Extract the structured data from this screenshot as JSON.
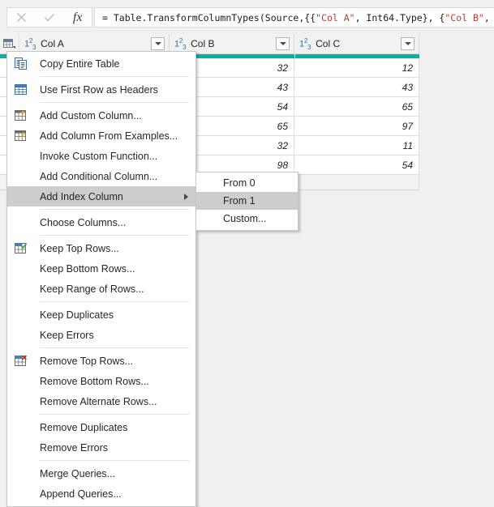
{
  "formula_bar": {
    "cancel_icon": "close-icon",
    "accept_icon": "check-icon",
    "fx_label": "fx",
    "formula_prefix": "= Table.TransformColumnTypes(Source,{{",
    "formula_str1": "\"Col A\"",
    "formula_mid1": ", Int64.Type}, {",
    "formula_str2": "\"Col B\"",
    "formula_suffix": ", Int"
  },
  "grid": {
    "corner_icon": "select-all-table-icon",
    "type_icon_label": "123",
    "columns": [
      {
        "name": "Col A",
        "type": "whole-number",
        "filter_icon": "chevron-down-icon"
      },
      {
        "name": "Col B",
        "type": "whole-number",
        "filter_icon": "chevron-down-icon"
      },
      {
        "name": "Col C",
        "type": "whole-number",
        "filter_icon": "chevron-down-icon"
      }
    ],
    "rows": [
      {
        "a": "",
        "b": "32",
        "c": "12"
      },
      {
        "a": "",
        "b": "43",
        "c": "43"
      },
      {
        "a": "",
        "b": "54",
        "c": "65"
      },
      {
        "a": "",
        "b": "65",
        "c": "97"
      },
      {
        "a": "",
        "b": "32",
        "c": "11"
      },
      {
        "a": "",
        "b": "98",
        "c": "54"
      }
    ],
    "selection_color": "#00b3a4"
  },
  "context_menu": {
    "items": [
      {
        "label": "Copy Entire Table",
        "icon": "copy-icon",
        "sep_after": true,
        "highlight": false,
        "submenu": false
      },
      {
        "label": "Use First Row as Headers",
        "icon": "table-headers-icon",
        "sep_after": true,
        "highlight": false,
        "submenu": false
      },
      {
        "label": "Add Custom Column...",
        "icon": "add-custom-column-icon",
        "sep_after": false,
        "highlight": false,
        "submenu": false
      },
      {
        "label": "Add Column From Examples...",
        "icon": "add-column-examples-icon",
        "sep_after": false,
        "highlight": false,
        "submenu": false
      },
      {
        "label": "Invoke Custom Function...",
        "icon": "none",
        "sep_after": false,
        "highlight": false,
        "submenu": false
      },
      {
        "label": "Add Conditional Column...",
        "icon": "none",
        "sep_after": false,
        "highlight": false,
        "submenu": false
      },
      {
        "label": "Add Index Column",
        "icon": "none",
        "sep_after": true,
        "highlight": true,
        "submenu": true
      },
      {
        "label": "Choose Columns...",
        "icon": "none",
        "sep_after": true,
        "highlight": false,
        "submenu": false
      },
      {
        "label": "Keep Top Rows...",
        "icon": "keep-rows-icon",
        "sep_after": false,
        "highlight": false,
        "submenu": false
      },
      {
        "label": "Keep Bottom Rows...",
        "icon": "none",
        "sep_after": false,
        "highlight": false,
        "submenu": false
      },
      {
        "label": "Keep Range of Rows...",
        "icon": "none",
        "sep_after": true,
        "highlight": false,
        "submenu": false
      },
      {
        "label": "Keep Duplicates",
        "icon": "none",
        "sep_after": false,
        "highlight": false,
        "submenu": false
      },
      {
        "label": "Keep Errors",
        "icon": "none",
        "sep_after": true,
        "highlight": false,
        "submenu": false
      },
      {
        "label": "Remove Top Rows...",
        "icon": "remove-rows-icon",
        "sep_after": false,
        "highlight": false,
        "submenu": false
      },
      {
        "label": "Remove Bottom Rows...",
        "icon": "none",
        "sep_after": false,
        "highlight": false,
        "submenu": false
      },
      {
        "label": "Remove Alternate Rows...",
        "icon": "none",
        "sep_after": true,
        "highlight": false,
        "submenu": false
      },
      {
        "label": "Remove Duplicates",
        "icon": "none",
        "sep_after": false,
        "highlight": false,
        "submenu": false
      },
      {
        "label": "Remove Errors",
        "icon": "none",
        "sep_after": true,
        "highlight": false,
        "submenu": false
      },
      {
        "label": "Merge Queries...",
        "icon": "none",
        "sep_after": false,
        "highlight": false,
        "submenu": false
      },
      {
        "label": "Append Queries...",
        "icon": "none",
        "sep_after": false,
        "highlight": false,
        "submenu": false
      }
    ]
  },
  "submenu": {
    "items": [
      {
        "label": "From 0",
        "highlight": false
      },
      {
        "label": "From 1",
        "highlight": true
      },
      {
        "label": "Custom...",
        "highlight": false
      }
    ]
  }
}
